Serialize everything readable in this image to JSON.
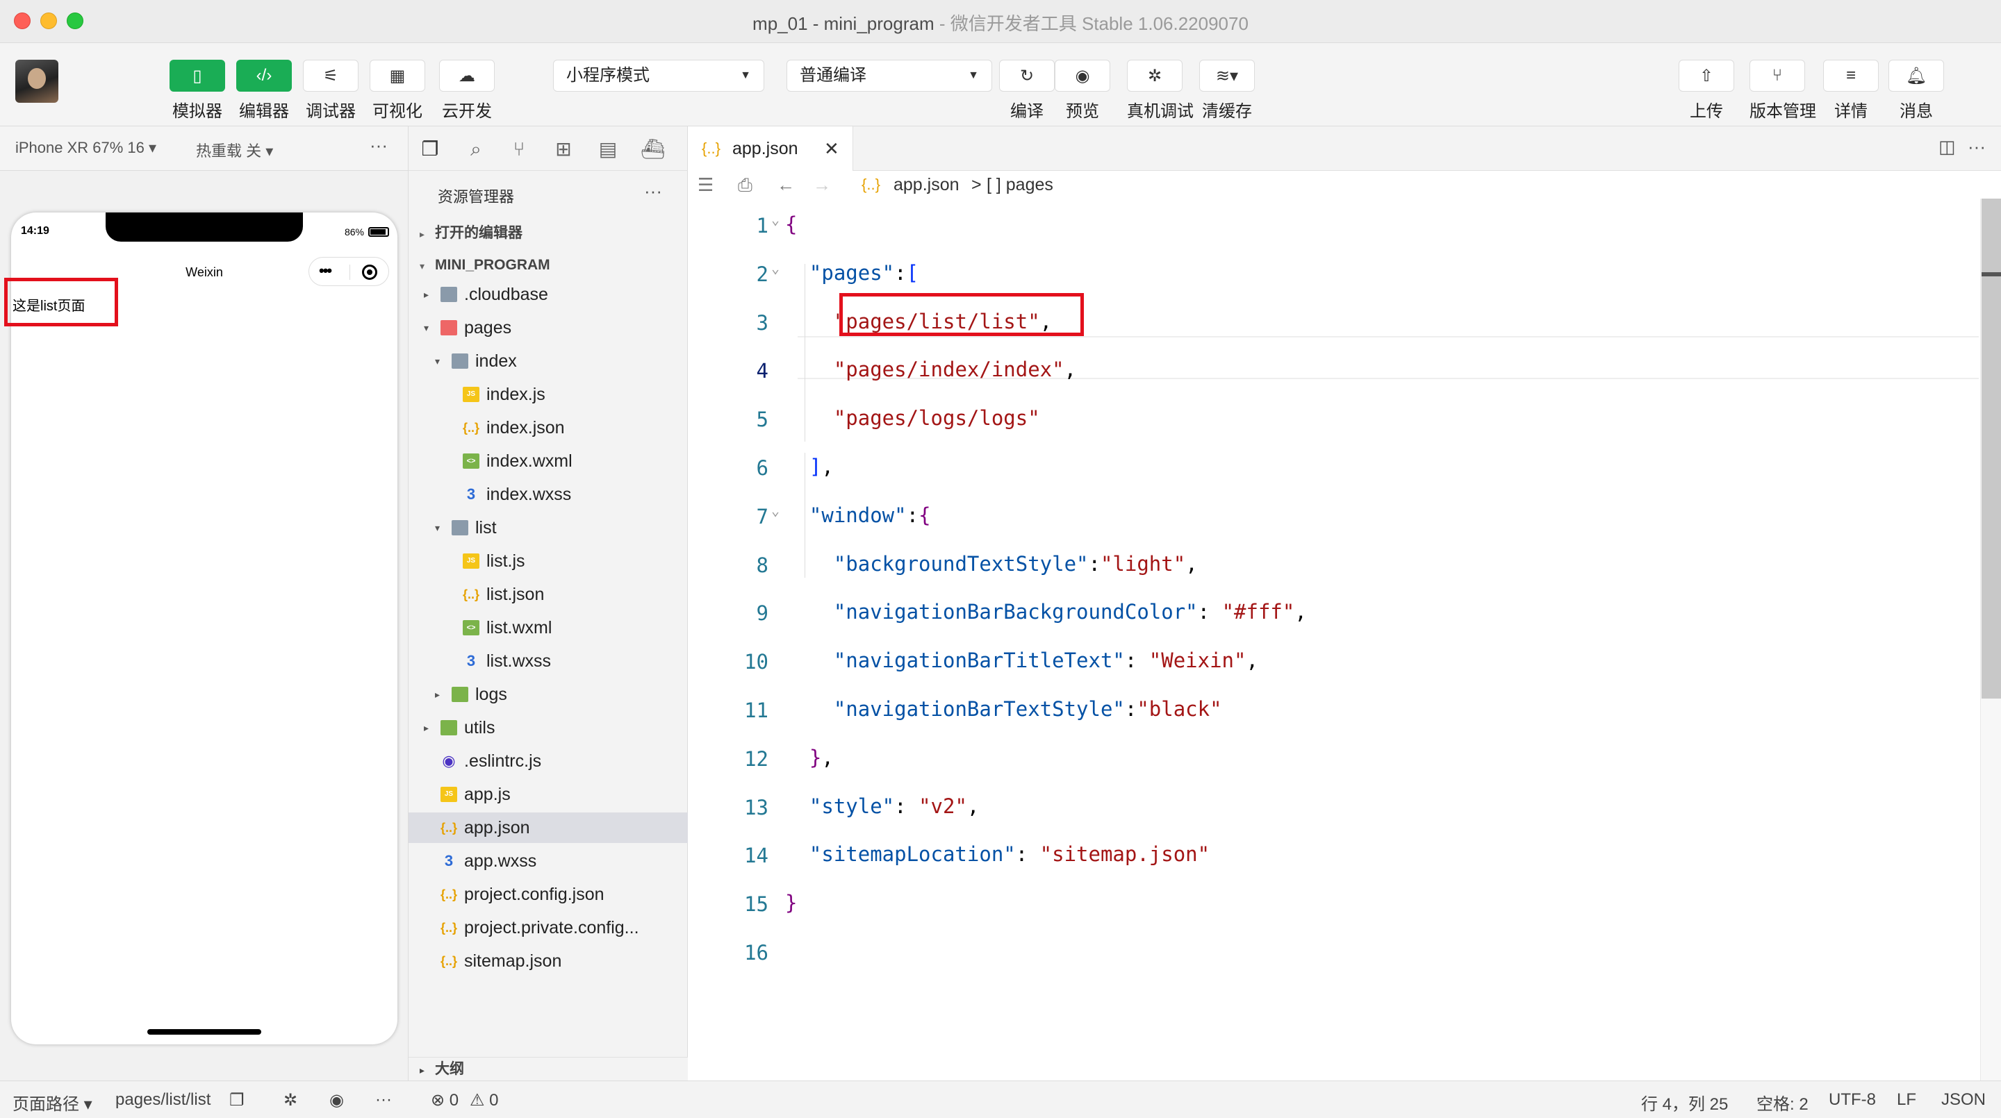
{
  "window": {
    "title": "mp_01 - mini_program",
    "subtitle": " - 微信开发者工具 Stable 1.06.2209070"
  },
  "toolbar": {
    "left_buttons": [
      {
        "label": "模拟器",
        "icon": "phone-icon"
      },
      {
        "label": "编辑器",
        "icon": "code-icon"
      },
      {
        "label": "调试器",
        "icon": "debug-sliders-icon"
      },
      {
        "label": "可视化",
        "icon": "layout-icon"
      },
      {
        "label": "云开发",
        "icon": "cloud-icon"
      }
    ],
    "mode_select": "小程序模式",
    "compile_select": "普通编译",
    "center_buttons": [
      {
        "label": "编译",
        "icon": "refresh-icon"
      },
      {
        "label": "预览",
        "icon": "eye-icon"
      },
      {
        "label": "真机调试",
        "icon": "bug-icon"
      },
      {
        "label": "清缓存",
        "icon": "layers-icon"
      }
    ],
    "right_buttons": [
      {
        "label": "上传",
        "icon": "upload-icon"
      },
      {
        "label": "版本管理",
        "icon": "branch-icon"
      },
      {
        "label": "详情",
        "icon": "menu-icon"
      },
      {
        "label": "消息",
        "icon": "bell-icon"
      }
    ]
  },
  "simulator": {
    "device": "iPhone XR 67% 16 ▾",
    "hot_reload": "热重载 关 ▾",
    "more": "···",
    "status_time": "14:19",
    "battery": "86%",
    "nav_title": "Weixin",
    "page_text": "这是list页面"
  },
  "explorer": {
    "title": "资源管理器",
    "more": "···",
    "open_editors": "打开的编辑器",
    "project": "MINI_PROGRAM",
    "outline": "大纲",
    "tree": [
      {
        "name": ".cloudbase",
        "type": "folder",
        "depth": 0,
        "arrow": "▸"
      },
      {
        "name": "pages",
        "type": "folder-red",
        "depth": 0,
        "arrow": "▾"
      },
      {
        "name": "index",
        "type": "folder",
        "depth": 1,
        "arrow": "▾"
      },
      {
        "name": "index.js",
        "type": "js",
        "depth": 2,
        "arrow": ""
      },
      {
        "name": "index.json",
        "type": "json",
        "depth": 2,
        "arrow": ""
      },
      {
        "name": "index.wxml",
        "type": "wxml",
        "depth": 2,
        "arrow": ""
      },
      {
        "name": "index.wxss",
        "type": "wxss",
        "depth": 2,
        "arrow": ""
      },
      {
        "name": "list",
        "type": "folder",
        "depth": 1,
        "arrow": "▾"
      },
      {
        "name": "list.js",
        "type": "js",
        "depth": 2,
        "arrow": ""
      },
      {
        "name": "list.json",
        "type": "json",
        "depth": 2,
        "arrow": ""
      },
      {
        "name": "list.wxml",
        "type": "wxml",
        "depth": 2,
        "arrow": ""
      },
      {
        "name": "list.wxss",
        "type": "wxss",
        "depth": 2,
        "arrow": ""
      },
      {
        "name": "logs",
        "type": "folder-green",
        "depth": 1,
        "arrow": "▸"
      },
      {
        "name": "utils",
        "type": "folder-green",
        "depth": 0,
        "arrow": "▸"
      },
      {
        "name": ".eslintrc.js",
        "type": "eslint",
        "depth": 0,
        "arrow": ""
      },
      {
        "name": "app.js",
        "type": "js",
        "depth": 0,
        "arrow": ""
      },
      {
        "name": "app.json",
        "type": "json",
        "depth": 0,
        "arrow": "",
        "selected": true
      },
      {
        "name": "app.wxss",
        "type": "wxss",
        "depth": 0,
        "arrow": ""
      },
      {
        "name": "project.config.json",
        "type": "json",
        "depth": 0,
        "arrow": ""
      },
      {
        "name": "project.private.config...",
        "type": "json",
        "depth": 0,
        "arrow": ""
      },
      {
        "name": "sitemap.json",
        "type": "json",
        "depth": 0,
        "arrow": ""
      }
    ]
  },
  "editor": {
    "tab": "app.json",
    "breadcrumb_file": "app.json",
    "breadcrumb_sep": ">",
    "breadcrumb_node": "[ ] pages",
    "lines": [
      "{",
      "  \"pages\":[",
      "    \"pages/list/list\",",
      "    \"pages/index/index\",",
      "    \"pages/logs/logs\"",
      "  ],",
      "  \"window\":{",
      "    \"backgroundTextStyle\":\"light\",",
      "    \"navigationBarBackgroundColor\": \"#fff\",",
      "    \"navigationBarTitleText\": \"Weixin\",",
      "    \"navigationBarTextStyle\":\"black\"",
      "  },",
      "  \"style\": \"v2\",",
      "  \"sitemapLocation\": \"sitemap.json\"",
      "}",
      ""
    ],
    "current_line": 4
  },
  "statusbar": {
    "page_path_label": "页面路径 ▾",
    "page_path": "pages/list/list",
    "errors": "⊗ 0",
    "warnings": "⚠ 0",
    "position": "行 4，列 25",
    "spaces": "空格: 2",
    "encoding": "UTF-8",
    "eol": "LF",
    "language": "JSON"
  },
  "colors": {
    "accent_green": "#1aad55",
    "highlight_red": "#e3101c"
  }
}
